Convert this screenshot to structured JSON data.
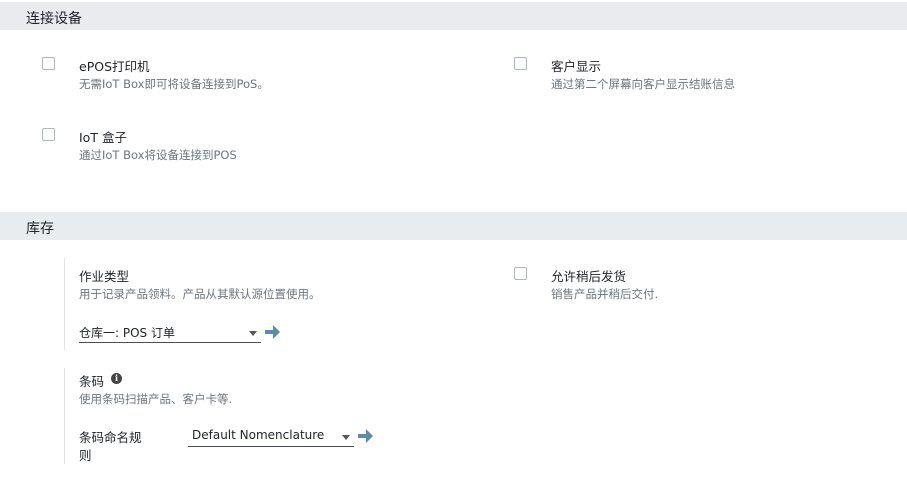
{
  "sections": {
    "connect": {
      "title": "连接设备"
    },
    "inventory": {
      "title": "库存"
    }
  },
  "epos": {
    "label": "ePOS打印机",
    "desc": "无需IoT Box即可将设备连接到PoS。"
  },
  "customer_display": {
    "label": "客户显示",
    "desc": "通过第二个屏幕向客户显示结账信息"
  },
  "iot_box": {
    "label": "IoT 盒子",
    "desc": "通过IoT Box将设备连接到POS"
  },
  "operation_type": {
    "label": "作业类型",
    "desc": "用于记录产品领料。产品从其默认源位置使用。",
    "value": "仓库一: POS 订单"
  },
  "ship_later": {
    "label": "允许稍后发货",
    "desc": "销售产品并稍后交付."
  },
  "barcode": {
    "label": "条码",
    "desc": "使用条码扫描产品、客户卡等.",
    "nomenclature_label_1": "条码命名规",
    "nomenclature_label_2": "则",
    "nomenclature_value": "Default Nomenclature"
  },
  "colors": {
    "arrow": "#5c8aa8",
    "header_bg": "#e9ecef"
  }
}
